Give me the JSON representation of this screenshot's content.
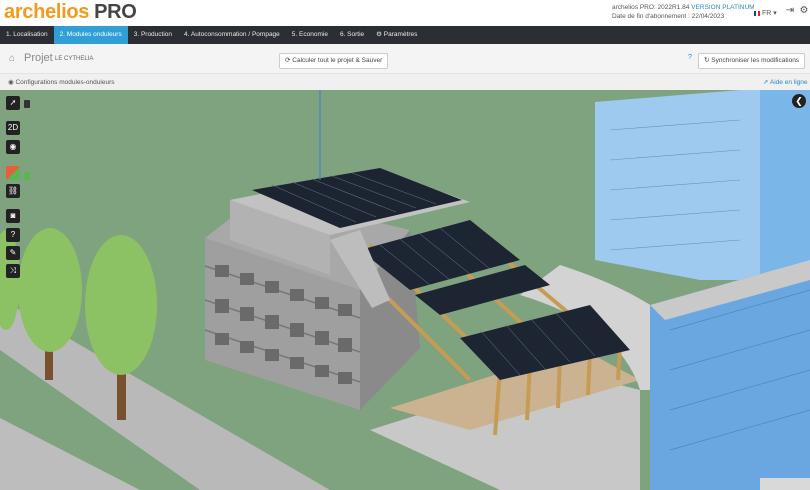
{
  "header": {
    "brand": "archelios",
    "pro": "PRO",
    "version": "archelios PRO: 2022R1.84",
    "plan": "VERSION PLATINUM",
    "subscription": "Date de fin d'abonnement : 22/04/2023",
    "language": "FR"
  },
  "nav": {
    "tabs": [
      {
        "label": "1. Localisation"
      },
      {
        "label": "2. Modules onduleurs"
      },
      {
        "label": "3. Production"
      },
      {
        "label": "4. Autoconsommation / Pompage"
      },
      {
        "label": "5. Economie"
      },
      {
        "label": "6. Sortie"
      },
      {
        "label": "Paramètres"
      }
    ],
    "active_index": 1
  },
  "project": {
    "title": "Projet",
    "name": "LE CYTHELIA",
    "calc_button": "Calculer tout le projet & Sauver",
    "sync_button": "Synchroniser les modifications"
  },
  "subbar": {
    "config": "Configurations modules-onduleurs",
    "help": "Aide en ligne"
  },
  "toolbar": {
    "mode_2d": "2D"
  },
  "colors": {
    "accent": "#2f9fd6",
    "brand": "#f39a1e",
    "nav_bg": "#2b2f33",
    "grass": "#7fa27f"
  }
}
